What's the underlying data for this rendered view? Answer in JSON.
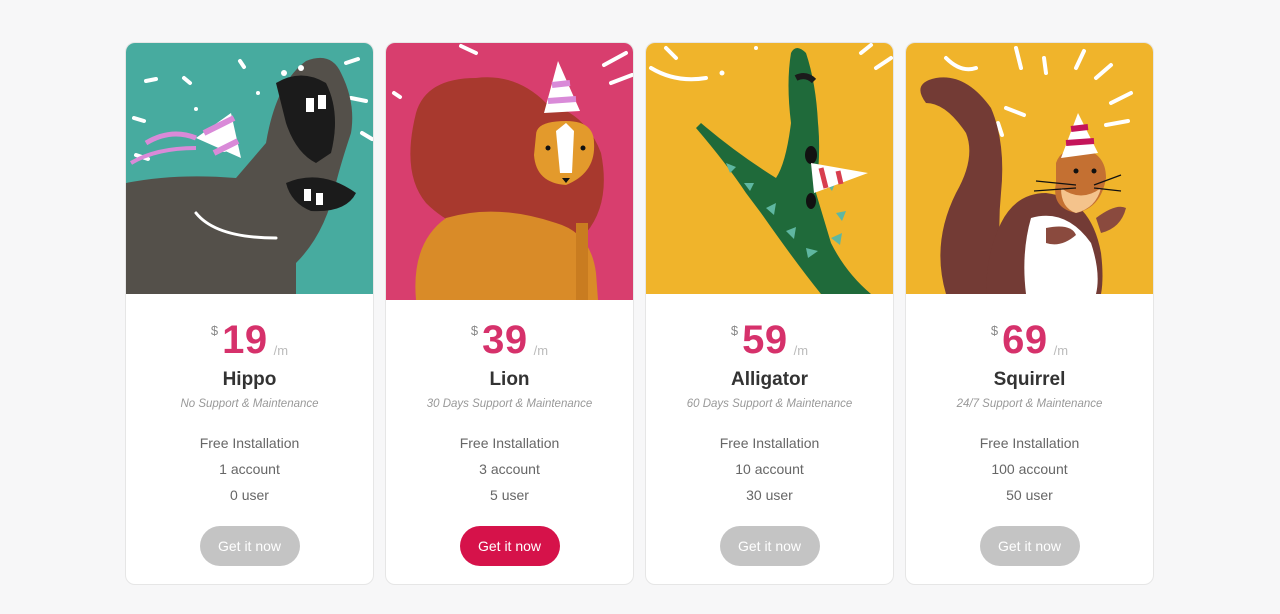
{
  "colors": {
    "price": "#d6316b",
    "button_default": "#c4c4c4",
    "button_featured": "#d6124a",
    "hippo_bg": "#47ab9f",
    "lion_bg": "#d83e6e",
    "alligator_bg": "#f0b42b",
    "squirrel_bg": "#f0b42b"
  },
  "plans": [
    {
      "illustration": "hippo-party-illustration",
      "currency": "$",
      "price": "19",
      "period": "/m",
      "name": "Hippo",
      "support": "No Support & Maintenance",
      "features": [
        "Free Installation",
        "1 account",
        "0 user"
      ],
      "cta": "Get it now",
      "featured": false
    },
    {
      "illustration": "lion-party-illustration",
      "currency": "$",
      "price": "39",
      "period": "/m",
      "name": "Lion",
      "support": "30 Days Support & Maintenance",
      "features": [
        "Free Installation",
        "3 account",
        "5 user"
      ],
      "cta": "Get it now",
      "featured": true
    },
    {
      "illustration": "alligator-party-illustration",
      "currency": "$",
      "price": "59",
      "period": "/m",
      "name": "Alligator",
      "support": "60 Days Support & Maintenance",
      "features": [
        "Free Installation",
        "10 account",
        "30 user"
      ],
      "cta": "Get it now",
      "featured": false
    },
    {
      "illustration": "squirrel-party-illustration",
      "currency": "$",
      "price": "69",
      "period": "/m",
      "name": "Squirrel",
      "support": "24/7 Support & Maintenance",
      "features": [
        "Free Installation",
        "100 account",
        "50 user"
      ],
      "cta": "Get it now",
      "featured": false
    }
  ]
}
